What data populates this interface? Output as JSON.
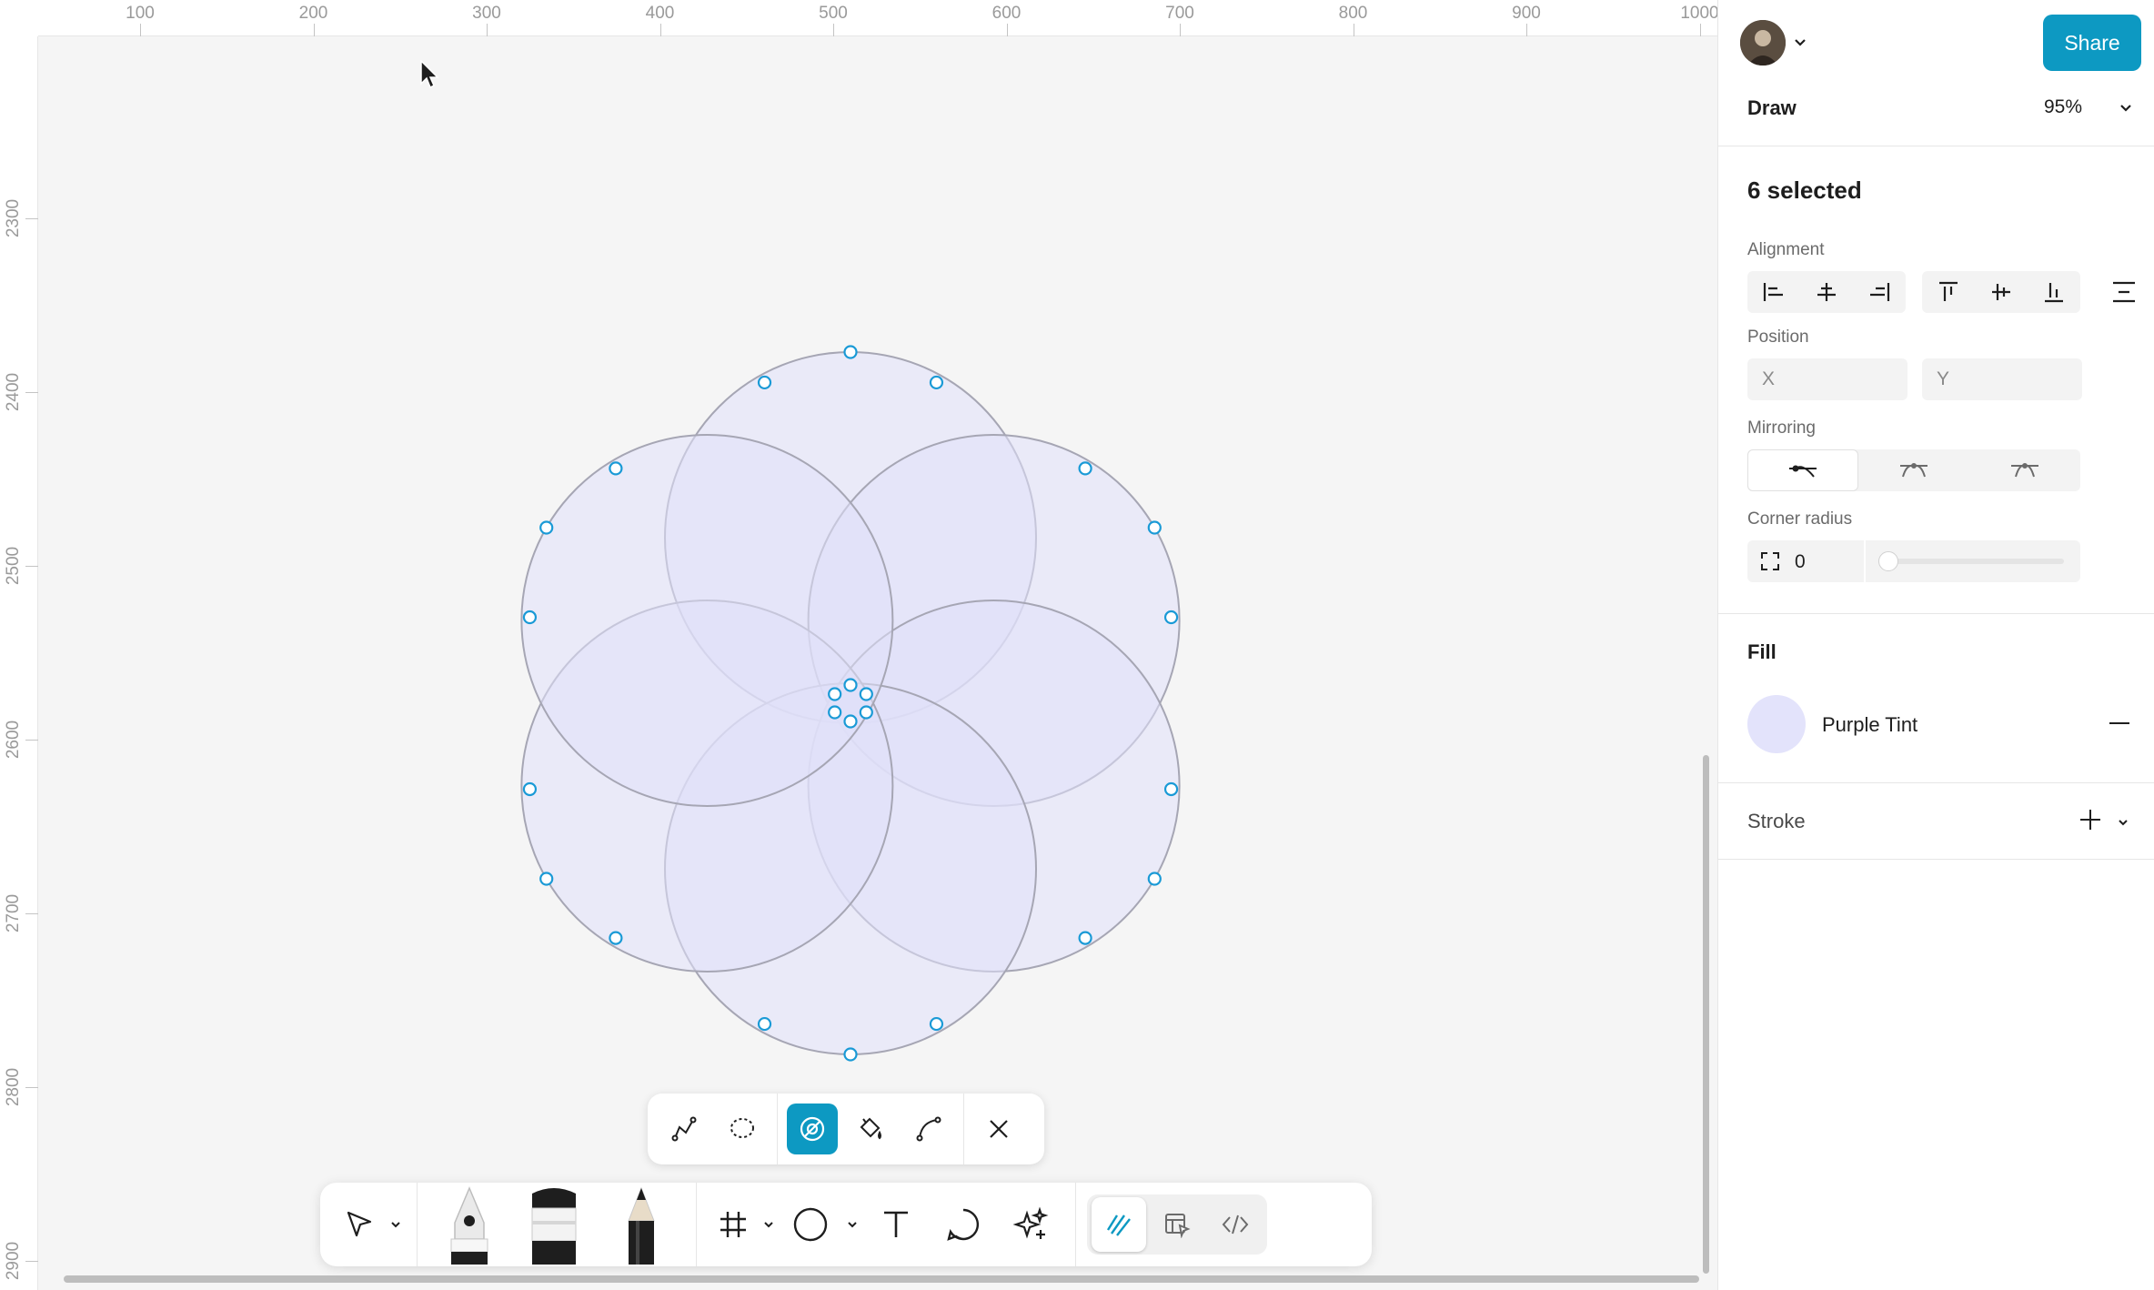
{
  "ruler": {
    "top_ticks": [
      "100",
      "200",
      "300",
      "400",
      "500",
      "600",
      "700",
      "800",
      "900",
      "1000"
    ],
    "left_ticks": [
      "2300",
      "2400",
      "2500",
      "2600",
      "2700",
      "2800",
      "2900"
    ]
  },
  "canvas": {
    "shape_fill": "#e0e0fa",
    "shape_stroke": "#a6a6b4",
    "handle_color": "#1a9ad6"
  },
  "sub_toolbar": {
    "tools": [
      {
        "name": "select-points-tool",
        "icon": "pen-node-icon"
      },
      {
        "name": "lasso-tool",
        "icon": "lasso-icon"
      },
      {
        "name": "shape-builder-tool",
        "icon": "shape-builder-icon",
        "active": true
      },
      {
        "name": "paint-bucket-tool",
        "icon": "paint-bucket-icon"
      },
      {
        "name": "bend-tool",
        "icon": "bend-curve-icon"
      },
      {
        "name": "close-edit-tool",
        "icon": "close-icon"
      }
    ]
  },
  "main_toolbar": {
    "tools": [
      "move-tool",
      "pen-tool",
      "brush-tool",
      "pencil-tool",
      "frame-tool",
      "ellipse-tool",
      "text-tool",
      "comment-tool",
      "ai-tool"
    ],
    "modes": [
      "draw-mode",
      "design-mode",
      "dev-mode"
    ]
  },
  "panel": {
    "share_label": "Share",
    "mode_label": "Draw",
    "zoom": "95%",
    "selection_title": "6 selected",
    "alignment_label": "Alignment",
    "position_label": "Position",
    "x_placeholder": "X",
    "y_placeholder": "Y",
    "mirroring_label": "Mirroring",
    "corner_radius_label": "Corner radius",
    "corner_radius_value": "0",
    "fill_label": "Fill",
    "fill_name": "Purple Tint",
    "fill_color": "#e3e3fb",
    "stroke_label": "Stroke",
    "accent_color": "#0d99c2"
  }
}
